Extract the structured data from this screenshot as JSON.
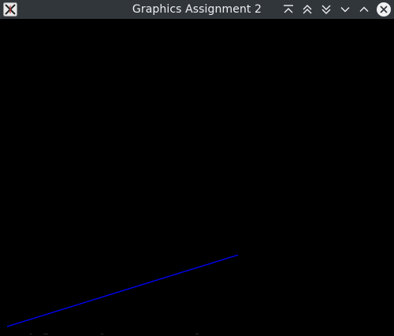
{
  "window": {
    "title": "Graphics Assignment 2",
    "icon": "x-window-icon",
    "controls": [
      {
        "name": "keep-above-button",
        "icon": "keep-above-icon"
      },
      {
        "name": "shade-up-button",
        "icon": "double-chevron-up-icon"
      },
      {
        "name": "shade-down-button",
        "icon": "double-chevron-down-icon"
      },
      {
        "name": "minimize-button",
        "icon": "chevron-down-icon"
      },
      {
        "name": "maximize-button",
        "icon": "chevron-up-icon"
      },
      {
        "name": "close-button",
        "icon": "close-icon"
      }
    ]
  },
  "canvas": {
    "background": "#000000",
    "line": {
      "color": "#0000ff"
    }
  },
  "colors": {
    "titlebar_bg": "#31363b",
    "titlebar_fg": "#eff0f1"
  }
}
